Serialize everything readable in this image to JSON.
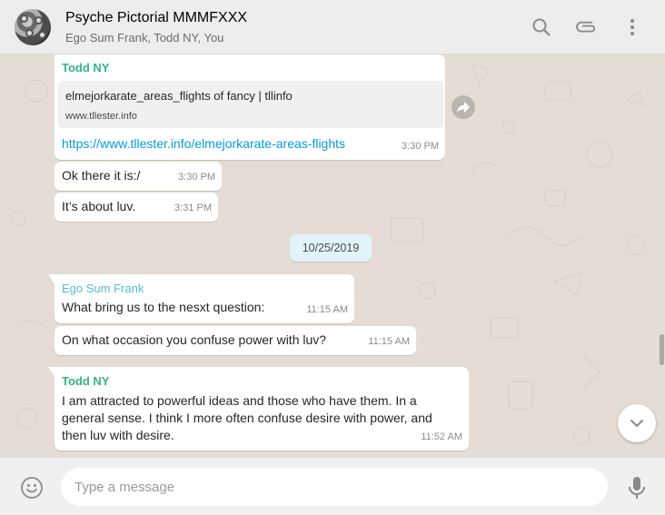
{
  "header": {
    "title": "Psyche Pictorial MMMFXXX",
    "subtitle": "Ego Sum Frank, Todd NY, You",
    "icons": [
      "search-icon",
      "attach-icon",
      "menu-icon"
    ]
  },
  "messages": {
    "m1": {
      "sender": "Todd NY",
      "link_title": "elmejorkarate_areas_flights of fancy | tllinfo",
      "link_domain": "www.tllester.info",
      "url": "https://www.tllester.info/elmejorkarate-areas-flights",
      "time": "3:30 PM"
    },
    "m2": {
      "text": "Ok there it is:/",
      "time": "3:30 PM"
    },
    "m3": {
      "text": "It’s about luv.",
      "time": "3:31 PM"
    },
    "date_divider": "10/25/2019",
    "m4": {
      "sender": "Ego Sum Frank",
      "text": "What bring us to the nesxt question:",
      "time": "11:15 AM"
    },
    "m5": {
      "text": "On what occasion you confuse power with luv?",
      "time": "11:15 AM"
    },
    "m6": {
      "sender": "Todd NY",
      "lines": [
        "I am attracted to powerful ideas and those who have them. In a",
        "general sense. I think I more often confuse desire with power, and",
        "then luv with desire."
      ],
      "time": "11:52 AM"
    }
  },
  "composer": {
    "placeholder": "Type a message"
  },
  "colors": {
    "todd": "#35b38a",
    "ego": "#52bdd3",
    "link": "#039be5",
    "date_pill": "#e1f3fb"
  }
}
